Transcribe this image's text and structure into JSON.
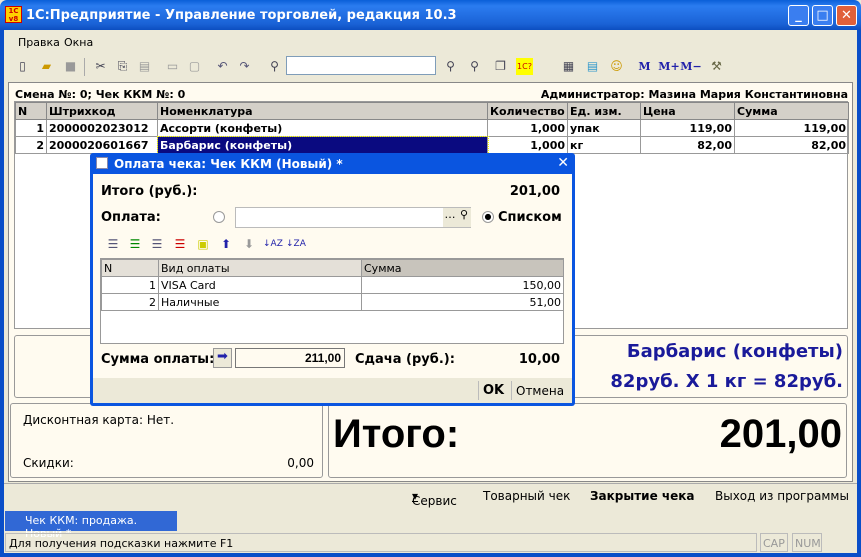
{
  "window": {
    "title": "1С:Предприятие - Управление торговлей, редакция 10.3",
    "logo": "1С v8",
    "minimize": "_",
    "maximize": "□",
    "close": "✕"
  },
  "menu": [
    "Правка",
    "Окна"
  ],
  "toolbar": {
    "search_value": "",
    "buttons": [
      "new-icon",
      "open-icon",
      "save-icon",
      "cut-icon",
      "copy-icon",
      "paste-icon",
      "print-icon",
      "preview-icon",
      "undo-icon",
      "redo-icon",
      "find-icon",
      "find-next-icon",
      "find-prev-icon",
      "windows-icon",
      "help-icon",
      "calculator-icon",
      "calendar-icon",
      "user-lock-icon",
      "tools-icon"
    ],
    "m": "M",
    "mplus": "M+",
    "mminus": "M−"
  },
  "doc": {
    "header_left": "Смена №: 0; Чек ККМ №: 0",
    "header_right": "Администратор: Мазина Мария Константиновна",
    "columns": [
      "N",
      "Штрихкод",
      "Номенклатура",
      "Количество",
      "Ед. изм.",
      "Цена",
      "Сумма"
    ],
    "rows": [
      [
        "1",
        "2000002023012",
        "Ассорти (конфеты)",
        "1,000",
        "упак",
        "119,00",
        "119,00"
      ],
      [
        "2",
        "2000020601667",
        "Барбарис (конфеты)",
        "1,000",
        "кг",
        "82,00",
        "82,00"
      ]
    ]
  },
  "current_item": {
    "name": "Барбарис (конфеты)",
    "detail": "82руб. X 1 кг = 82руб.",
    "color": "#1a1a9a"
  },
  "discount": {
    "card": "Дисконтная карта: Нет.",
    "label": "Скидки:",
    "value": "0,00"
  },
  "total": {
    "label": "Итого:",
    "value": "201,00"
  },
  "commands": {
    "service": "Сервис",
    "receipt": "Товарный чек",
    "close_check": "Закрытие чека",
    "exit": "Выход из программы"
  },
  "taskbar": {
    "tab": "Чек ККМ: продажа. Новый *"
  },
  "status": {
    "hint": "Для получения подсказки нажмите F1",
    "cap": "CAP",
    "num": "NUM"
  },
  "dialog": {
    "title": "Оплата чека: Чек ККМ (Новый) *",
    "close": "✕",
    "total_label": "Итого (руб.):",
    "total_value": "201,00",
    "payment_label": "Оплата:",
    "payment_value": "",
    "list_label": "Списком",
    "list_selected": true,
    "columns": [
      "N",
      "Вид оплаты",
      "Сумма"
    ],
    "rows": [
      [
        "1",
        "VISA Card",
        "150,00"
      ],
      [
        "2",
        "Наличные",
        "51,00"
      ]
    ],
    "sum_label": "Сумма оплаты:",
    "sum_value": "211,00",
    "change_label": "Сдача (руб.):",
    "change_value": "10,00",
    "ok": "OK",
    "cancel": "Отмена"
  }
}
